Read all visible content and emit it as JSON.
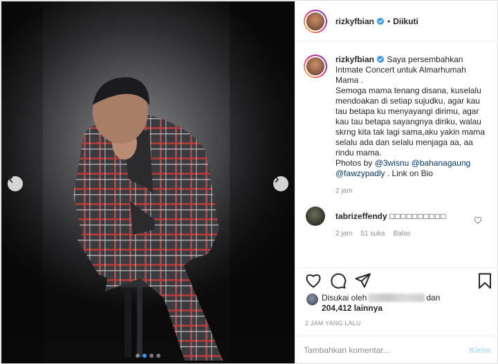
{
  "post": {
    "username": "rizkyfbian",
    "follow_separator": "•",
    "follow_status": "Diikuti"
  },
  "caption": {
    "username": "rizkyfbian",
    "text_before": "Saya persembahkan Intmate Concert untuk Almarhumah Mama .\nSemoga mama tenang disana, kuselalu mendoakan di setiap sujudku, agar kau tau betapa ku menyayangi dirimu, agar kau tau betapa sayangnya diriku, walau skrng kita tak lagi sama,aku yakin mama selalu ada dan selalu menjaga aa, aa rindu mama.\nPhotos by ",
    "mention1": "@3wisnu",
    "mention2": "@bahanagaung",
    "mention3": "@fawzypadly",
    "text_after": ". Link on Bio",
    "time": "2 jam"
  },
  "comment": {
    "username": "tabrizeffendy",
    "text": "□□□□□□□□□□",
    "time": "2 jam",
    "likes": "51 suka",
    "reply": "Balas"
  },
  "likes": {
    "prefix": "Disukai oleh",
    "suffix": "dan",
    "count": "204,412 lainnya"
  },
  "timestamp": "2 JAM YANG LALU",
  "add_comment": {
    "placeholder": "Tambahkan komentar...",
    "post_label": "Kirim"
  },
  "carousel": {
    "slides": 4,
    "active_index": 1
  },
  "colors": {
    "verified": "#3897f0",
    "mention": "#00376b",
    "post_disabled": "#b2dffc"
  },
  "icons": [
    "verified-badge-icon",
    "heart-icon",
    "comment-icon",
    "share-icon",
    "bookmark-icon",
    "chevron-left-icon",
    "chevron-right-icon"
  ]
}
